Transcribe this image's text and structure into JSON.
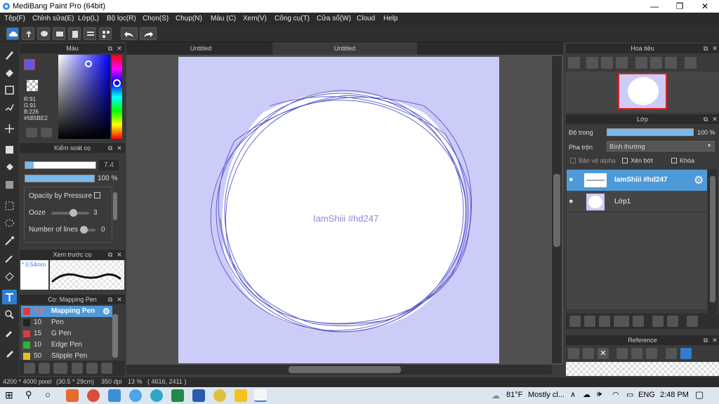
{
  "window": {
    "title": "MediBang Paint Pro (64bit)",
    "buttons": [
      "—",
      "❐",
      "✕"
    ]
  },
  "menu": [
    "Tệp(F)",
    "Chỉnh sửa(E)",
    "Lớp(L)",
    "Bộ lọc(R)",
    "Chọn(S)",
    "Chụp(N)",
    "Màu (C)",
    "Xem(V)",
    "Công cụ(T)",
    "Cửa sổ(W)",
    "Cloud",
    "Help"
  ],
  "color_panel": {
    "title": "Màu",
    "readout": {
      "r": "R:91",
      "g": "G:91",
      "b": "B:226",
      "hex": "#5B5BE2"
    },
    "accent": "#5b5be2"
  },
  "brush_control": {
    "title": "Kiểm soát cọ",
    "size_value": "7.4",
    "opacity_value": "100 %",
    "opacity_pressure_label": "Opacity by Pressure",
    "ooze_label": "Ooze",
    "ooze_value": "3",
    "lines_label": "Number of lines",
    "lines_value": "0"
  },
  "brush_preview": {
    "title": "Xem trước cọ",
    "size": "* 0.54mm"
  },
  "brush_list": {
    "title": "Cọ: Mapping Pen",
    "items": [
      {
        "size": "7.4",
        "name": "Mapping Pen",
        "color": "#e03a3a",
        "selected": true
      },
      {
        "size": "10",
        "name": "Pen",
        "color": "#222222",
        "selected": false
      },
      {
        "size": "15",
        "name": "G Pen",
        "color": "#e03a3a",
        "selected": false
      },
      {
        "size": "10",
        "name": "Edge Pen",
        "color": "#2fb52f",
        "selected": false
      },
      {
        "size": "50",
        "name": "Stipple Pen",
        "color": "#e0c020",
        "selected": false
      }
    ]
  },
  "tabs": [
    "Untitled",
    "Untitled"
  ],
  "canvas": {
    "background": "#ccccf8",
    "watermark": "IamShiii #hd247",
    "stroke_color": "#5555cc"
  },
  "navigator": {
    "title": "Hoa tiêu"
  },
  "layers": {
    "title": "Lớp",
    "opacity_label": "Độ trong",
    "opacity_value": "100 %",
    "blend_label": "Pha trộn",
    "blend_value": "Bình thường",
    "protect_alpha": "Bảo vệ alpha",
    "clipping": "Xén bớt",
    "lock": "Khóa",
    "items": [
      {
        "name": "IamShiii #hd247",
        "selected": true
      },
      {
        "name": "Lớp1",
        "selected": false
      }
    ]
  },
  "reference": {
    "title": "Reference"
  },
  "status": {
    "size": "4200 * 4000 pixel",
    "physical": "(30.5 * 29cm)",
    "dpi": "350 dpi",
    "zoom": "13 %",
    "coords": "( 4616, 2411 )"
  },
  "taskbar": {
    "temp": "81°F",
    "weather": "Mostly cl...",
    "lang": "ENG",
    "time": "2:48 PM"
  }
}
